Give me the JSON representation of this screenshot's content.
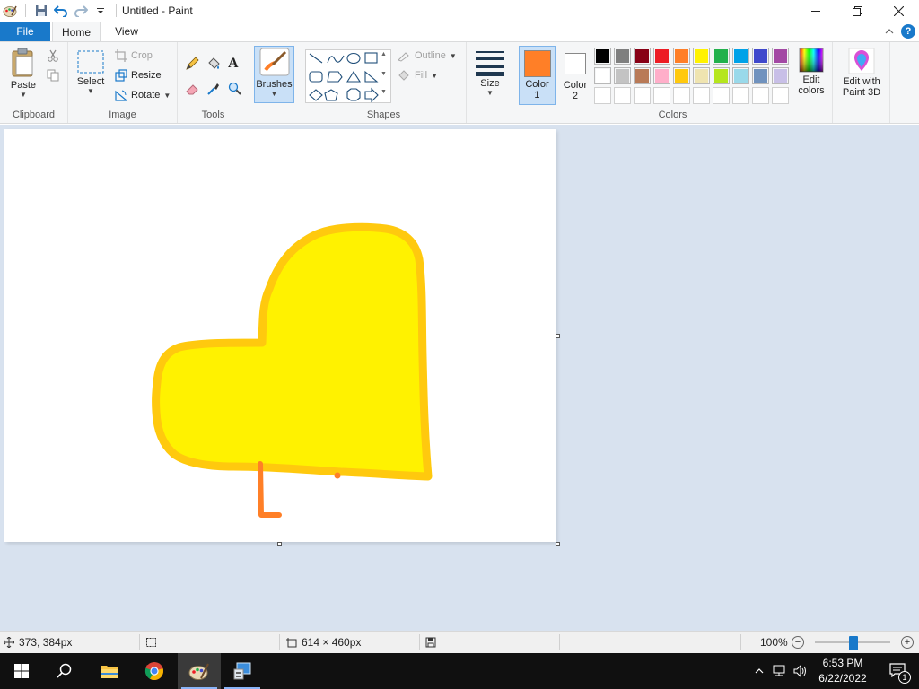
{
  "window": {
    "title": "Untitled - Paint"
  },
  "tabs": {
    "file": "File",
    "home": "Home",
    "view": "View"
  },
  "ribbon": {
    "clipboard": {
      "label": "Clipboard",
      "paste": "Paste"
    },
    "image": {
      "label": "Image",
      "select": "Select",
      "crop": "Crop",
      "resize": "Resize",
      "rotate": "Rotate"
    },
    "tools": {
      "label": "Tools"
    },
    "brushes": {
      "label": "Brushes"
    },
    "shapes": {
      "label": "Shapes",
      "outline": "Outline",
      "fill": "Fill"
    },
    "size": {
      "label": "Size"
    },
    "colors": {
      "label": "Colors",
      "color1_line1": "Color",
      "color1_line2": "1",
      "color2_line1": "Color",
      "color2_line2": "2",
      "color1": "#ff7f27",
      "color2": "#ffffff",
      "edit_line1": "Edit",
      "edit_line2": "colors",
      "palette_row1": [
        "#000000",
        "#7f7f7f",
        "#880015",
        "#ed1c24",
        "#ff7f27",
        "#fff200",
        "#22b14c",
        "#00a2e8",
        "#3f48cc",
        "#a349a4"
      ],
      "palette_row2": [
        "#ffffff",
        "#c3c3c3",
        "#b97a57",
        "#ffaec9",
        "#ffc90e",
        "#efe4b0",
        "#b5e61d",
        "#99d9ea",
        "#7092be",
        "#c8bfe7"
      ]
    },
    "paint3d": {
      "line1": "Edit with",
      "line2": "Paint 3D"
    }
  },
  "canvas_drawing": {
    "heart_fill": "#fff200",
    "heart_outline": "#ffc90e",
    "stroke_color": "#ff7f27"
  },
  "status": {
    "cursor_pos": "373, 384px",
    "canvas_size": "614 × 460px",
    "zoom": "100%"
  },
  "taskbar": {
    "time": "6:53 PM",
    "date": "6/22/2022",
    "notification_count": "1"
  }
}
